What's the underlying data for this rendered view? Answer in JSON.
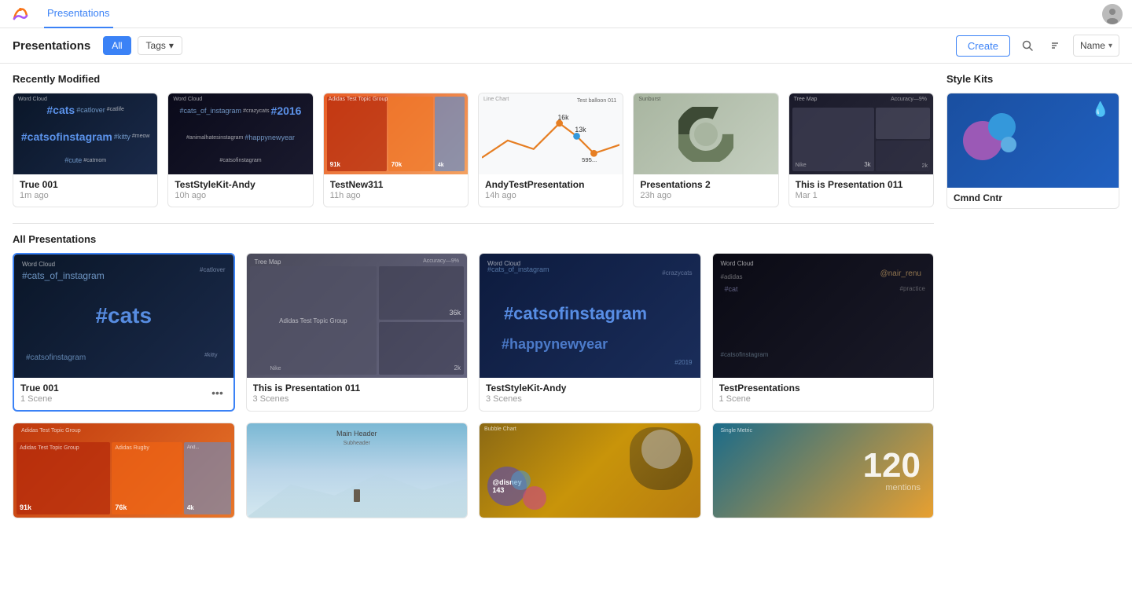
{
  "app": {
    "logo_alt": "Flourish logo"
  },
  "nav": {
    "active_tab": "Presentations",
    "tabs": [
      "Presentations"
    ]
  },
  "toolbar": {
    "title": "Presentations",
    "filter_all": "All",
    "filter_tags": "Tags",
    "create_label": "Create",
    "sort_label": "Name"
  },
  "recently_modified": {
    "section_title": "Recently Modified",
    "cards": [
      {
        "name": "True 001",
        "meta": "1m ago",
        "thumb": "cats-dark"
      },
      {
        "name": "TestStyleKit-Andy",
        "meta": "10h ago",
        "thumb": "instagram-dark"
      },
      {
        "name": "TestNew311",
        "meta": "11h ago",
        "thumb": "orange-red"
      },
      {
        "name": "AndyTestPresentation",
        "meta": "14h ago",
        "thumb": "line-chart"
      },
      {
        "name": "Presentations 2",
        "meta": "23h ago",
        "thumb": "donut"
      },
      {
        "name": "This is Presentation 011",
        "meta": "Mar 1",
        "thumb": "tree-dark"
      }
    ]
  },
  "style_kits": {
    "section_title": "Style Kits",
    "cards": [
      {
        "name": "Cmnd Cntr",
        "thumb": "cmnd-cntr"
      }
    ]
  },
  "all_presentations": {
    "section_title": "All Presentations",
    "rows": [
      [
        {
          "name": "True 001",
          "meta": "1 Scene",
          "thumb": "cats-dark",
          "selected": true
        },
        {
          "name": "This is Presentation 011",
          "meta": "3 Scenes",
          "thumb": "treemap-grey"
        },
        {
          "name": "TestStyleKit-Andy",
          "meta": "3 Scenes",
          "thumb": "cats-blue"
        },
        {
          "name": "TestPresentations",
          "meta": "1 Scene",
          "thumb": "cats-dark2"
        }
      ],
      [
        {
          "name": "",
          "meta": "",
          "thumb": "orange-panels"
        },
        {
          "name": "",
          "meta": "",
          "thumb": "mountain"
        },
        {
          "name": "",
          "meta": "",
          "thumb": "squirrel"
        },
        {
          "name": "",
          "meta": "",
          "thumb": "metric"
        }
      ]
    ]
  },
  "icons": {
    "search": "🔍",
    "sort": "⇅",
    "chevron_down": "▾",
    "more": "•••",
    "droplet": "💧"
  }
}
